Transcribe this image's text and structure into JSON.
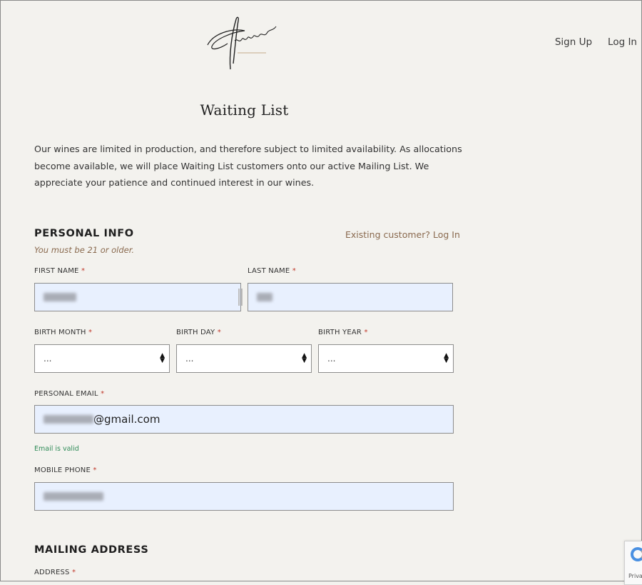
{
  "brand": {
    "logo_text": "Aubert"
  },
  "nav": {
    "sign_up": "Sign Up",
    "log_in": "Log In"
  },
  "page": {
    "title": "Waiting List",
    "intro": "Our wines are limited in production, and therefore subject to limited availability. As allocations become available, we will place Waiting List customers onto our active Mailing List. We appreciate your patience and continued interest in our wines."
  },
  "personal_info": {
    "heading": "PERSONAL INFO",
    "existing_customer": "Existing customer? Log In",
    "age_note": "You must be 21 or older.",
    "first_name_label": "FIRST NAME",
    "last_name_label": "LAST NAME",
    "birth_month_label": "BIRTH MONTH",
    "birth_day_label": "BIRTH DAY",
    "birth_year_label": "BIRTH YEAR",
    "birth_month_value": "...",
    "birth_day_value": "...",
    "birth_year_value": "...",
    "email_label": "PERSONAL EMAIL",
    "email_value_visible": "@gmail.com",
    "email_valid": "Email is valid",
    "mobile_label": "MOBILE PHONE",
    "required_mark": "*"
  },
  "mailing_address": {
    "heading": "MAILING ADDRESS",
    "address_label": "ADDRESS"
  },
  "recaptcha": {
    "text": "Priva"
  },
  "colors": {
    "accent_brown": "#8a6a4f",
    "required_red": "#c0392b",
    "valid_green": "#2e8b57",
    "autofill_blue": "#e8f0fe"
  }
}
